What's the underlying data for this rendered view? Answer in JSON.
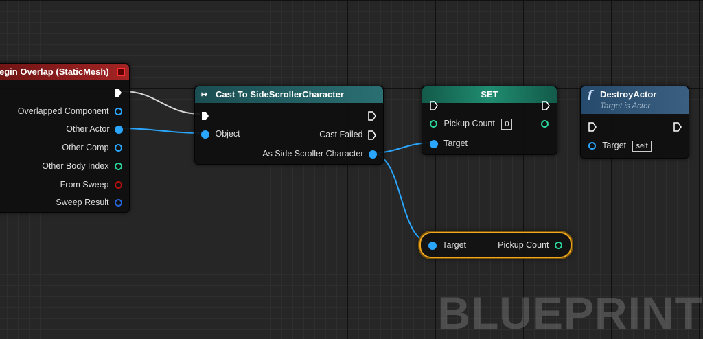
{
  "event_node": {
    "title": "egin Overlap (StaticMesh)",
    "pins": [
      "Overlapped Component",
      "Other Actor",
      "Other Comp",
      "Other Body Index",
      "From Sweep",
      "Sweep Result"
    ]
  },
  "cast_node": {
    "title": "Cast To SideScrollerCharacter",
    "object_label": "Object",
    "cast_failed_label": "Cast Failed",
    "as_label": "As Side Scroller Character"
  },
  "set_node": {
    "title": "SET",
    "pickup_label": "Pickup Count",
    "pickup_value": "0",
    "target_label": "Target"
  },
  "destroy_node": {
    "title": "DestroyActor",
    "subtitle": "Target is Actor",
    "target_label": "Target",
    "target_value": "self"
  },
  "getter_node": {
    "target_label": "Target",
    "output_label": "Pickup Count"
  },
  "watermark": "BLUEPRINT",
  "colors": {
    "event_header": "#8c1a1a",
    "cast_header": "#1f5f63",
    "set_header": "#1c7a63",
    "function_header": "#2c4a66",
    "object_pin": "#2aa6ff",
    "int_pin": "#2bd59a",
    "selection": "#f2a81e"
  }
}
